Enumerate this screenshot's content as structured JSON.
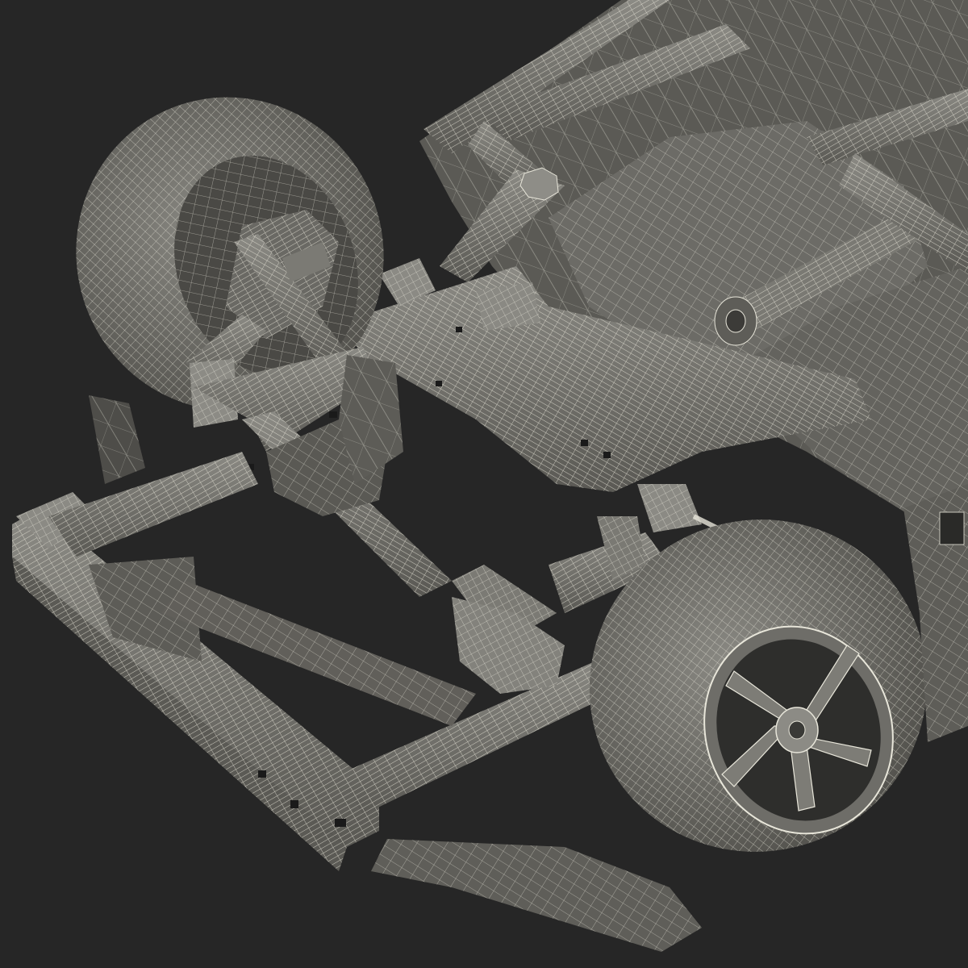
{
  "scene": {
    "background": "#262626",
    "surface_fill": "#6e6d68",
    "surface_fill_dark": "#4f4e4a",
    "surface_fill_light": "#86857f",
    "wire_color": "#e8e6da"
  }
}
